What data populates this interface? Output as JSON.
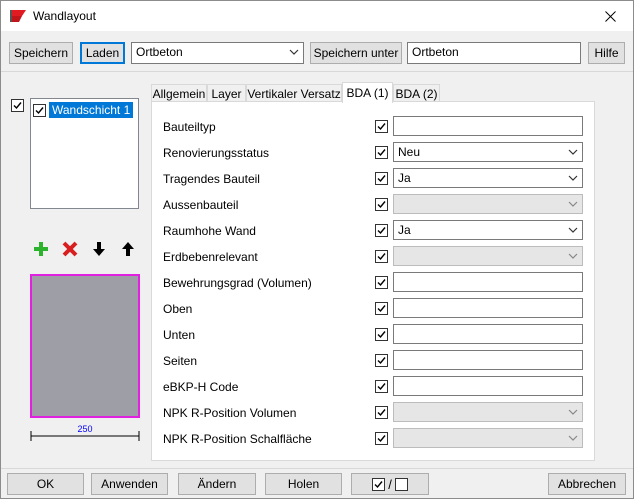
{
  "window": {
    "title": "Wandlayout"
  },
  "toolbar": {
    "save_label": "Speichern",
    "load_label": "Laden",
    "template_value": "Ortbeton",
    "save_as_label": "Speichern unter",
    "name_value": "Ortbeton",
    "help_label": "Hilfe"
  },
  "layers": {
    "items": [
      {
        "label": "Wandschicht 1",
        "checked": true
      }
    ],
    "dimension": "250"
  },
  "tabs": [
    {
      "label": "Allgemein"
    },
    {
      "label": "Layer"
    },
    {
      "label": "Vertikaler Versatz"
    },
    {
      "label": "BDA (1)"
    },
    {
      "label": "BDA (2)"
    }
  ],
  "properties": [
    {
      "label": "Bauteiltyp",
      "kind": "text",
      "value": ""
    },
    {
      "label": "Renovierungsstatus",
      "kind": "combo",
      "value": "Neu"
    },
    {
      "label": "Tragendes Bauteil",
      "kind": "combo",
      "value": "Ja"
    },
    {
      "label": "Aussenbauteil",
      "kind": "combo-disabled",
      "value": ""
    },
    {
      "label": "Raumhohe Wand",
      "kind": "combo",
      "value": "Ja"
    },
    {
      "label": "Erdbebenrelevant",
      "kind": "combo-disabled",
      "value": ""
    },
    {
      "label": "Bewehrungsgrad (Volumen)",
      "kind": "text",
      "value": ""
    },
    {
      "label": "Oben",
      "kind": "text",
      "value": ""
    },
    {
      "label": "Unten",
      "kind": "text",
      "value": ""
    },
    {
      "label": "Seiten",
      "kind": "text",
      "value": ""
    },
    {
      "label": "eBKP-H Code",
      "kind": "text",
      "value": ""
    },
    {
      "label": "NPK R-Position Volumen",
      "kind": "combo-disabled",
      "value": ""
    },
    {
      "label": "NPK R-Position Schalfläche",
      "kind": "combo-disabled",
      "value": ""
    }
  ],
  "footer": {
    "ok_label": "OK",
    "apply_label": "Anwenden",
    "change_label": "Ändern",
    "fetch_label": "Holen",
    "toggle_sep": "/",
    "cancel_label": "Abbrechen"
  },
  "colors": {
    "accent": "#0078d7",
    "preview_fill": "#9e9fa6",
    "preview_border": "#e021e0",
    "dimension": "#0000ff"
  }
}
